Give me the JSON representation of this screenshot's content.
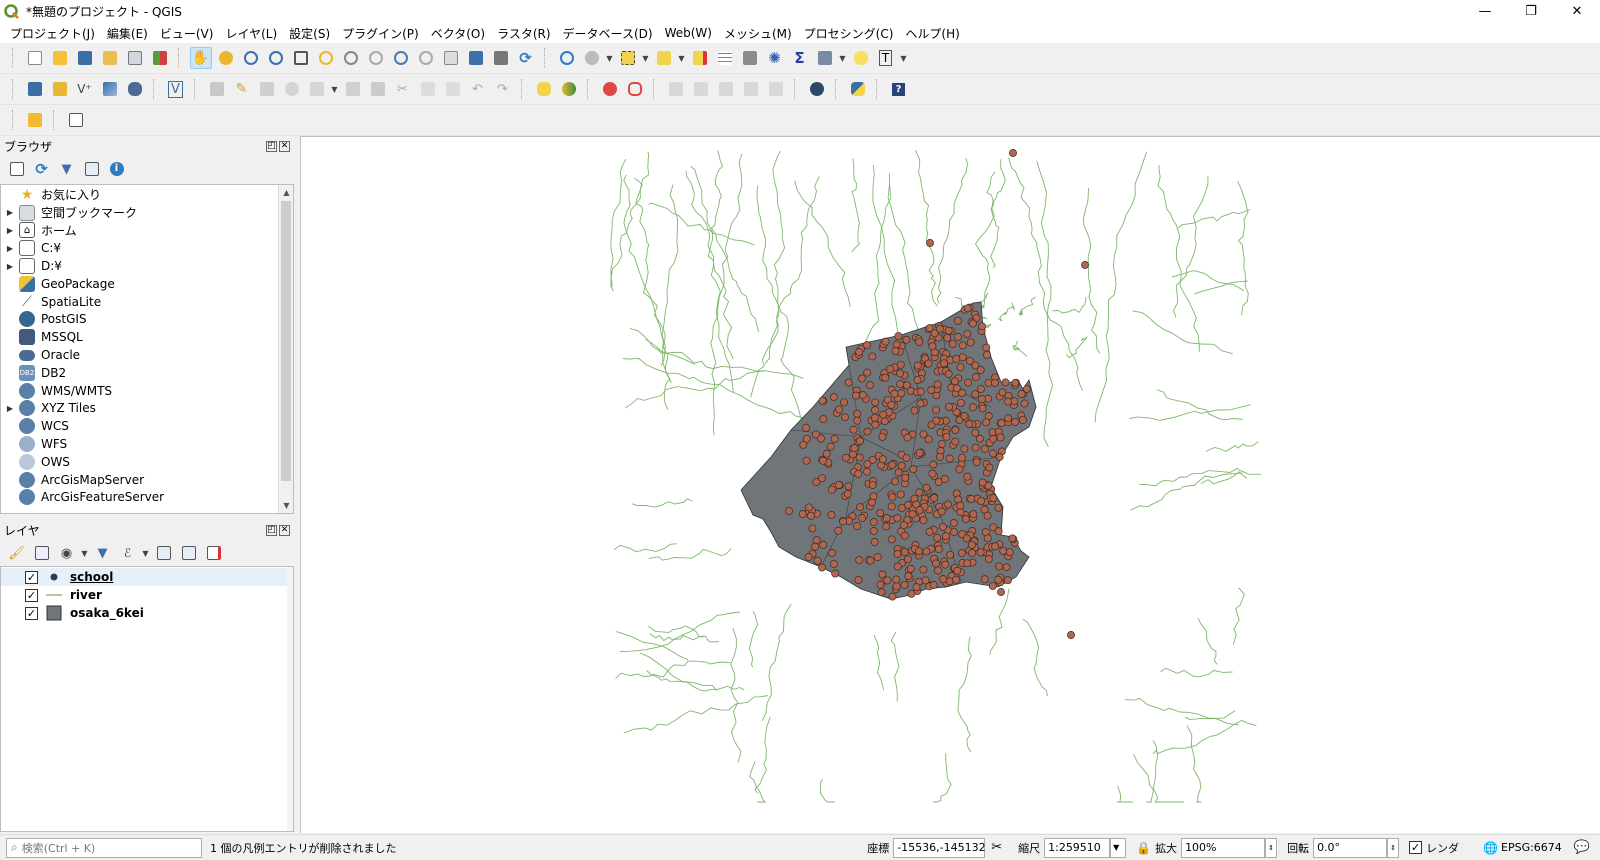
{
  "window": {
    "title": "*無題のプロジェクト - QGIS",
    "buttons": {
      "minimize": "—",
      "maximize": "❐",
      "close": "✕"
    }
  },
  "menu": [
    "プロジェクト(J)",
    "編集(E)",
    "ビュー(V)",
    "レイヤ(L)",
    "設定(S)",
    "プラグイン(P)",
    "ベクタ(O)",
    "ラスタ(R)",
    "データベース(D)",
    "Web(W)",
    "メッシュ(M)",
    "プロセシング(C)",
    "ヘルプ(H)"
  ],
  "browser": {
    "title": "ブラウザ",
    "items": [
      {
        "label": "お気に入り",
        "icon": "star-icon",
        "expand": false
      },
      {
        "label": "空間ブックマーク",
        "icon": "bookmark-icon",
        "expand": true
      },
      {
        "label": "ホーム",
        "icon": "home-icon",
        "expand": true
      },
      {
        "label": "C:¥",
        "icon": "folder-icon",
        "expand": true
      },
      {
        "label": "D:¥",
        "icon": "folder-icon",
        "expand": true
      },
      {
        "label": "GeoPackage",
        "icon": "geopackage-icon",
        "expand": false
      },
      {
        "label": "SpatiaLite",
        "icon": "spatialite-icon",
        "expand": false
      },
      {
        "label": "PostGIS",
        "icon": "postgis-icon",
        "expand": false
      },
      {
        "label": "MSSQL",
        "icon": "mssql-icon",
        "expand": false
      },
      {
        "label": "Oracle",
        "icon": "oracle-icon",
        "expand": false
      },
      {
        "label": "DB2",
        "icon": "db2-icon",
        "expand": false
      },
      {
        "label": "WMS/WMTS",
        "icon": "globe-icon",
        "expand": false
      },
      {
        "label": "XYZ Tiles",
        "icon": "globe-icon",
        "expand": true
      },
      {
        "label": "WCS",
        "icon": "globe-icon",
        "expand": false
      },
      {
        "label": "WFS",
        "icon": "globe-icon",
        "expand": false
      },
      {
        "label": "OWS",
        "icon": "globe-icon",
        "expand": false
      },
      {
        "label": "ArcGisMapServer",
        "icon": "globe-icon",
        "expand": false
      },
      {
        "label": "ArcGisFeatureServer",
        "icon": "globe-icon",
        "expand": false
      }
    ]
  },
  "layers": {
    "title": "レイヤ",
    "items": [
      {
        "label": "school",
        "checked": true,
        "symbol": "point"
      },
      {
        "label": "river",
        "checked": true,
        "symbol": "line"
      },
      {
        "label": "osaka_6kei",
        "checked": true,
        "symbol": "polygon"
      }
    ]
  },
  "status": {
    "search_placeholder": "検索(Ctrl + K)",
    "message": "1 個の凡例エントリが削除されました",
    "coord_label": "座標",
    "coord_value": "-15536,-145132",
    "scale_label": "縮尺",
    "scale_value": "1:259510",
    "magnify_label": "拡大",
    "magnify_value": "100%",
    "rotation_label": "回転",
    "rotation_value": "0.0°",
    "render_label": "レンダ",
    "crs": "EPSG:6674"
  },
  "colors": {
    "polygon_fill": "#6f7579",
    "river": "#7cb86a",
    "school": "#b0664f",
    "school_stroke": "#3c2b24"
  }
}
